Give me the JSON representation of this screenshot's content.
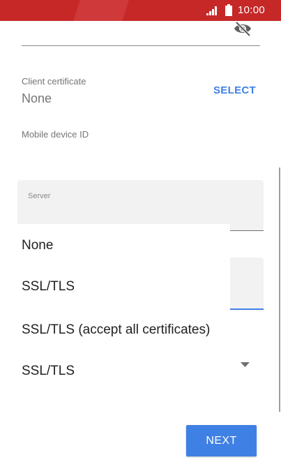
{
  "status_bar": {
    "time": "10:00",
    "background_color": "#c62828",
    "icons": [
      "signal-icon",
      "battery-icon"
    ]
  },
  "password_field": {
    "toggle_icon": "eye-off-icon"
  },
  "client_certificate": {
    "label": "Client certificate",
    "value": "None",
    "select_label": "SELECT"
  },
  "mobile_device_id": {
    "label": "Mobile device ID"
  },
  "server": {
    "label": "Server"
  },
  "security_dropdown": {
    "options": [
      "None",
      "SSL/TLS",
      "SSL/TLS (accept all certificates)"
    ],
    "selected": "SSL/TLS",
    "caret_icon": "dropdown-caret-icon"
  },
  "next_label": "NEXT",
  "colors": {
    "accent": "#3f80e4",
    "field_background": "#f2f2f2",
    "muted_text": "#757575"
  }
}
